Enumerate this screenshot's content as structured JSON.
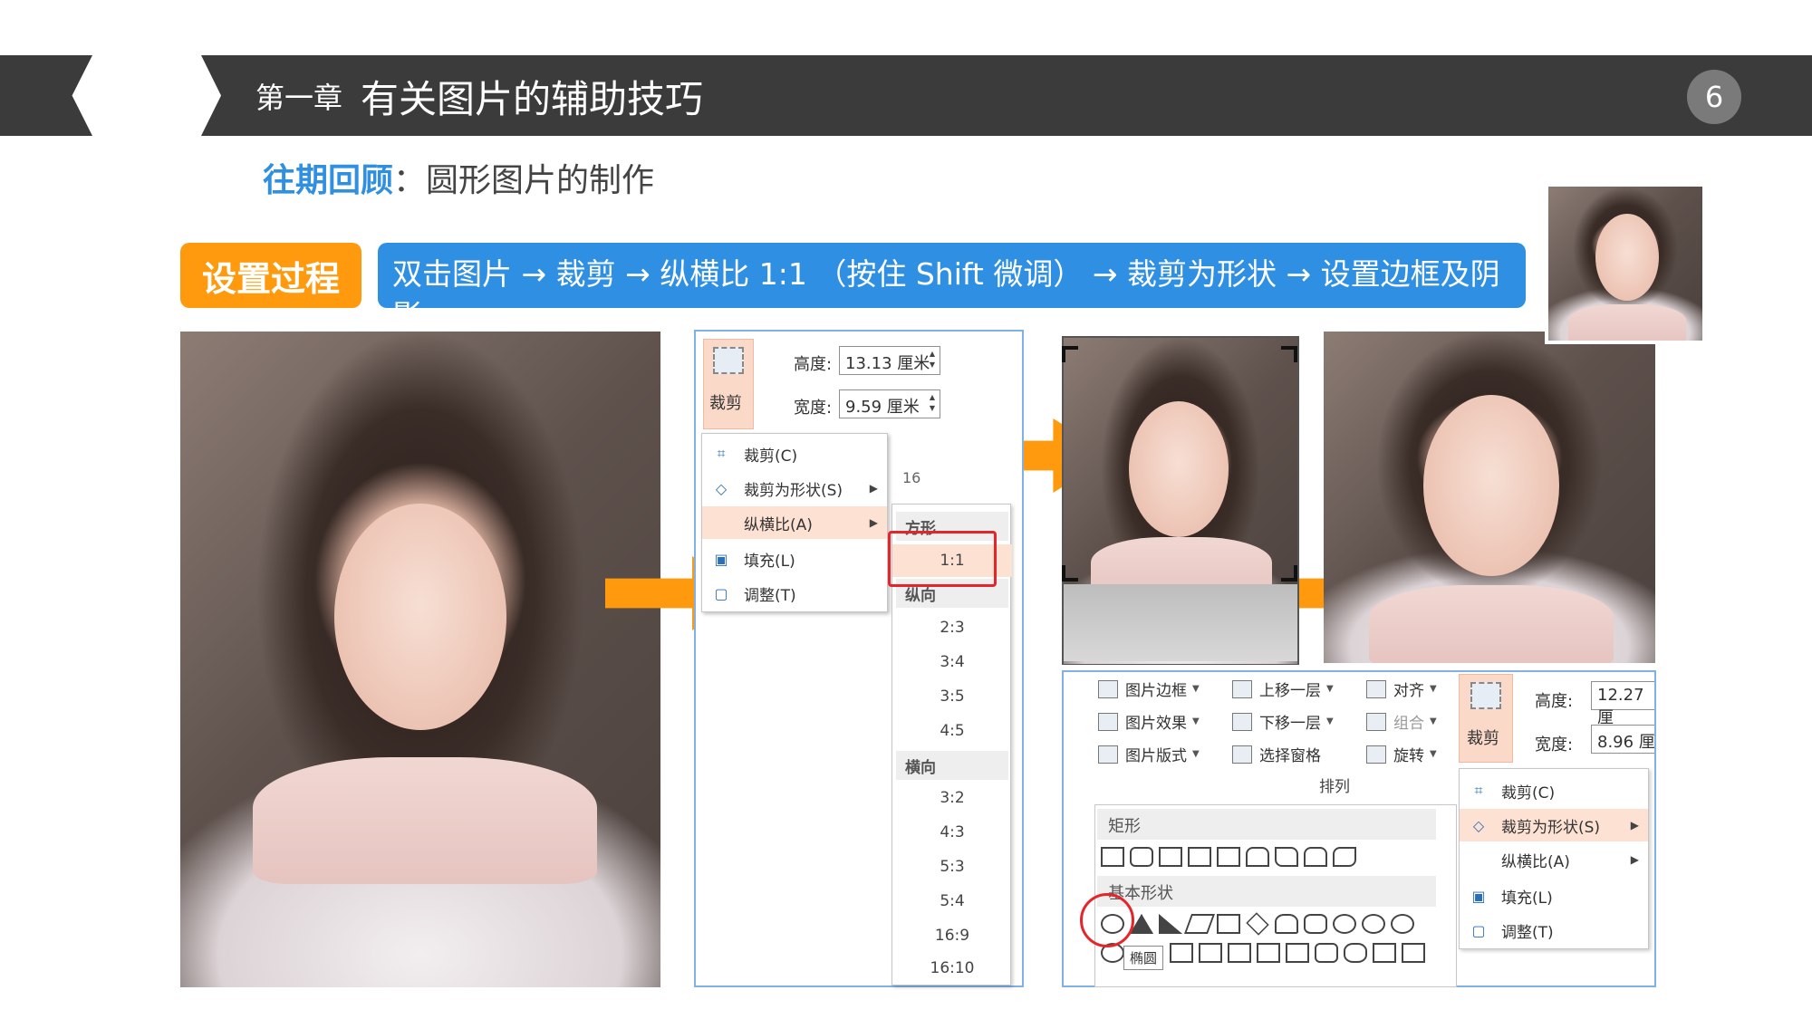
{
  "header": {
    "chapter": "第一章",
    "title": "有关图片的辅助技巧",
    "page_number": "6"
  },
  "subtitle": {
    "highlight": "往期回顾",
    "text": "：圆形图片的制作"
  },
  "process": {
    "label": "设置过程",
    "steps": "双击图片 → 裁剪 → 纵横比 1:1 （按住 Shift 微调） → 裁剪为形状 → 设置边框及阴影"
  },
  "panel1": {
    "crop_button": "裁剪",
    "height_label": "高度:",
    "height_value": "13.13 厘米",
    "width_label": "宽度:",
    "width_value": "9.59 厘米",
    "ruler_value": "16",
    "menu": [
      {
        "label": "裁剪(C)",
        "icon": "crop-icon"
      },
      {
        "label": "裁剪为形状(S)",
        "icon": "shape-crop-icon"
      },
      {
        "label": "纵横比(A)",
        "icon": ""
      },
      {
        "label": "填充(L)",
        "icon": "fill-icon"
      },
      {
        "label": "调整(T)",
        "icon": "fit-icon"
      }
    ],
    "ratio_sections": {
      "square": "方形",
      "portrait": "纵向",
      "landscape": "横向"
    },
    "ratio_square": [
      "1:1"
    ],
    "ratio_portrait": [
      "2:3",
      "3:4",
      "3:5",
      "4:5"
    ],
    "ratio_landscape": [
      "3:2",
      "4:3",
      "5:3",
      "5:4",
      "16:9",
      "16:10"
    ]
  },
  "panel2": {
    "col1": [
      "图片边框",
      "图片效果",
      "图片版式"
    ],
    "col2": [
      "上移一层",
      "下移一层",
      "选择窗格"
    ],
    "col3": [
      "对齐",
      "组合",
      "旋转"
    ],
    "group_label": "排列",
    "crop_button": "裁剪",
    "height_label": "高度:",
    "height_value": "12.27 厘",
    "width_label": "宽度:",
    "width_value": "8.96 厘",
    "shape_sections": {
      "rect": "矩形",
      "basic": "基本形状"
    },
    "tooltip": "椭圆",
    "menu": [
      {
        "label": "裁剪(C)",
        "icon": "crop-icon"
      },
      {
        "label": "裁剪为形状(S)",
        "icon": "shape-crop-icon"
      },
      {
        "label": "纵横比(A)",
        "icon": ""
      },
      {
        "label": "填充(L)",
        "icon": "fill-icon"
      },
      {
        "label": "调整(T)",
        "icon": "fit-icon"
      }
    ]
  },
  "colors": {
    "header_bg": "#3b3b3b",
    "accent_orange": "#ff9a0e",
    "accent_blue": "#2e8fe3",
    "highlight_red": "#e5252a"
  }
}
